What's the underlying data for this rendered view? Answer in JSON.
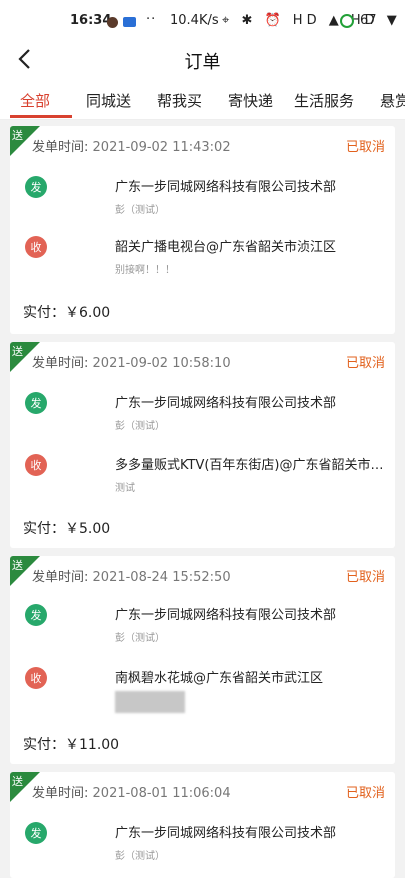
{
  "status_bar": {
    "time": "16:34",
    "dots": "··",
    "net_speed": "10.4K/s",
    "icons": "⌖ ✱ ⏰ HD ▲ HD ▼",
    "battery": "67"
  },
  "header": {
    "title": "订单"
  },
  "tabs": [
    {
      "label": "全部",
      "active": true
    },
    {
      "label": "同城送"
    },
    {
      "label": "帮我买"
    },
    {
      "label": "寄快递"
    },
    {
      "label": "生活服务"
    },
    {
      "label": "悬赏"
    }
  ],
  "orders": [
    {
      "tag": "送",
      "time_label": "发单时间:",
      "time": "2021-09-02 11:43:02",
      "status": "已取消",
      "send_badge": "发",
      "send_addr": "广东一步同城网络科技有限公司技术部",
      "send_sub": "彭（测试）",
      "recv_badge": "收",
      "recv_addr": "韶关广播电视台@广东省韶关市浈江区",
      "recv_sub": "别接啊！！！",
      "price": "实付：￥6.00"
    },
    {
      "tag": "送",
      "time_label": "发单时间:",
      "time": "2021-09-02 10:58:10",
      "status": "已取消",
      "send_badge": "发",
      "send_addr": "广东一步同城网络科技有限公司技术部",
      "send_sub": "彭（测试）",
      "recv_badge": "收",
      "recv_addr": "多多量贩式KTV(百年东街店)@广东省韶关市浈...",
      "recv_sub": "测试",
      "price": "实付：￥5.00"
    },
    {
      "tag": "送",
      "time_label": "发单时间:",
      "time": "2021-08-24 15:52:50",
      "status": "已取消",
      "send_badge": "发",
      "send_addr": "广东一步同城网络科技有限公司技术部",
      "send_sub": "彭（测试）",
      "recv_badge": "收",
      "recv_addr": "南枫碧水花城@广东省韶关市武江区",
      "price": "实付：￥11.00"
    },
    {
      "tag": "送",
      "time_label": "发单时间:",
      "time": "2021-08-01 11:06:04",
      "status": "已取消",
      "send_badge": "发",
      "send_addr": "广东一步同城网络科技有限公司技术部",
      "send_sub": "彭（测试）"
    }
  ],
  "colors": {
    "accent": "#d8412f",
    "status": "#e2611d",
    "send_badge": "#27a86b",
    "recv_badge": "#e26355",
    "ribbon": "#2b8a3e"
  }
}
